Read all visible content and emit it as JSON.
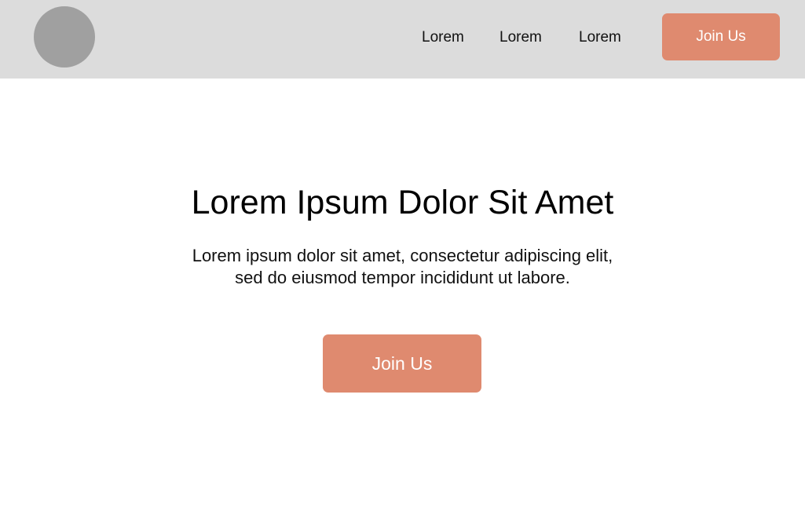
{
  "navbar": {
    "links": [
      "Lorem",
      "Lorem",
      "Lorem"
    ],
    "cta_label": "Join Us"
  },
  "hero": {
    "title": "Lorem Ipsum Dolor Sit Amet",
    "text_line1": "Lorem ipsum dolor sit amet, consectetur adipiscing elit,",
    "text_line2": "sed do eiusmod tempor incididunt ut labore.",
    "cta_label": "Join Us"
  },
  "colors": {
    "navbar_bg": "#dcdcdc",
    "logo_placeholder": "#a0a0a0",
    "accent": "#df8a6f"
  }
}
